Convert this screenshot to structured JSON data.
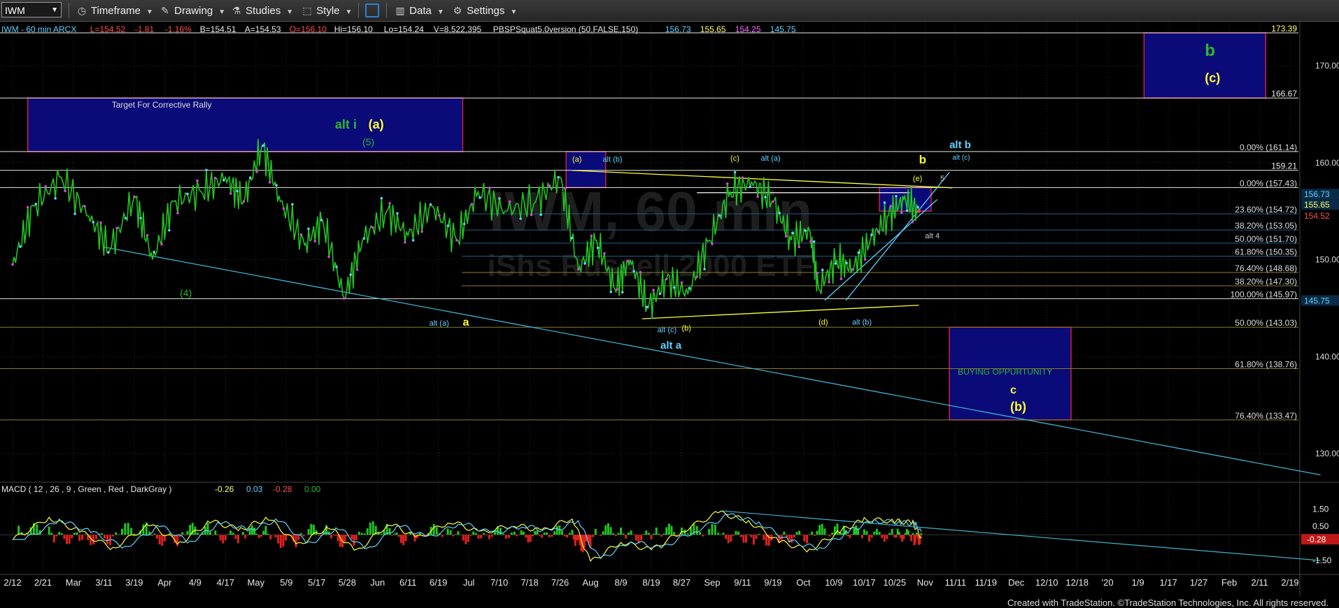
{
  "toolbar": {
    "symbol": "IWM",
    "items": [
      {
        "icon": "clock-icon",
        "label": "Timeframe"
      },
      {
        "icon": "pencil-icon",
        "label": "Drawing"
      },
      {
        "icon": "flask-icon",
        "label": "Studies"
      },
      {
        "icon": "brush-icon",
        "label": "Style"
      },
      {
        "icon": "layout-icon",
        "label": ""
      },
      {
        "icon": "bar-chart-icon",
        "label": "Data"
      },
      {
        "icon": "gear-icon",
        "label": "Settings"
      }
    ]
  },
  "header": {
    "title": "IWM - 60 min  ARCX",
    "stats": [
      {
        "text": "L=154.52",
        "color": "#ff4d4d"
      },
      {
        "text": "-1.81",
        "color": "#ff4d4d"
      },
      {
        "text": "-1.16%",
        "color": "#ff4d4d"
      },
      {
        "text": "B=154.51",
        "color": "#e8e8e8"
      },
      {
        "text": "A=154.53",
        "color": "#e8e8e8"
      },
      {
        "text": "O=156.10",
        "color": "#ff4d4d"
      },
      {
        "text": "Hi=156.10",
        "color": "#e8e8e8"
      },
      {
        "text": "Lo=154.24",
        "color": "#e8e8e8"
      },
      {
        "text": "V=8,522,395",
        "color": "#e8e8e8"
      },
      {
        "text": "PBSPSquat5.0version (50,FALSE,150)",
        "color": "#e8e8e8"
      },
      {
        "text": "156.73",
        "color": "#5fd3ff"
      },
      {
        "text": "155.65",
        "color": "#ffff66"
      },
      {
        "text": "154.25",
        "color": "#ff66ff"
      },
      {
        "text": "145.75",
        "color": "#5fd3ff"
      }
    ]
  },
  "watermark": {
    "line1": "IWM, 60 min",
    "line2": "iShs Russell 2000 ETF"
  },
  "footer": "Created with TradeStation. ©TradeStation Technologies, Inc. All rights reserved.",
  "chart_data": {
    "type": "line",
    "price_axis": {
      "ylim": [
        125,
        177
      ],
      "ticks": [
        130,
        140,
        150,
        160,
        170
      ]
    },
    "x_axis_labels": [
      "2/12",
      "2/21",
      "Mar",
      "3/11",
      "3/19",
      "Apr",
      "4/9",
      "4/17",
      "May",
      "5/9",
      "5/17",
      "5/28",
      "Jun",
      "6/11",
      "6/19",
      "Jul",
      "7/10",
      "7/18",
      "7/26",
      "Aug",
      "8/9",
      "8/19",
      "8/27",
      "Sep",
      "9/11",
      "9/19",
      "Oct",
      "10/9",
      "10/17",
      "10/25",
      "Nov",
      "11/11",
      "11/19",
      "Dec",
      "12/10",
      "12/18",
      "'20",
      "1/9",
      "1/17",
      "1/27",
      "Feb",
      "2/11",
      "2/19"
    ],
    "price_path": [
      {
        "x": 0,
        "y": 149.5
      },
      {
        "x": 0.7,
        "y": 155.5
      },
      {
        "x": 1.6,
        "y": 158.5
      },
      {
        "x": 2.5,
        "y": 154.5
      },
      {
        "x": 3.2,
        "y": 151
      },
      {
        "x": 4.0,
        "y": 156.5
      },
      {
        "x": 4.6,
        "y": 150
      },
      {
        "x": 5.3,
        "y": 156
      },
      {
        "x": 6.2,
        "y": 157
      },
      {
        "x": 7.0,
        "y": 158.5
      },
      {
        "x": 7.6,
        "y": 156
      },
      {
        "x": 8.2,
        "y": 161.8
      },
      {
        "x": 8.8,
        "y": 156
      },
      {
        "x": 9.6,
        "y": 151.5
      },
      {
        "x": 10.2,
        "y": 154
      },
      {
        "x": 10.9,
        "y": 146
      },
      {
        "x": 11.5,
        "y": 152
      },
      {
        "x": 12.3,
        "y": 155
      },
      {
        "x": 13.0,
        "y": 152.5
      },
      {
        "x": 13.8,
        "y": 155.5
      },
      {
        "x": 14.6,
        "y": 152
      },
      {
        "x": 15.3,
        "y": 157
      },
      {
        "x": 16.2,
        "y": 155
      },
      {
        "x": 17.2,
        "y": 156
      },
      {
        "x": 18.0,
        "y": 158.5
      },
      {
        "x": 18.6,
        "y": 149
      },
      {
        "x": 19.2,
        "y": 152
      },
      {
        "x": 19.8,
        "y": 147
      },
      {
        "x": 20.3,
        "y": 150
      },
      {
        "x": 20.9,
        "y": 145
      },
      {
        "x": 21.5,
        "y": 148
      },
      {
        "x": 22.2,
        "y": 146.5
      },
      {
        "x": 22.9,
        "y": 152
      },
      {
        "x": 23.6,
        "y": 157
      },
      {
        "x": 24.3,
        "y": 158
      },
      {
        "x": 25.0,
        "y": 156
      },
      {
        "x": 25.6,
        "y": 152
      },
      {
        "x": 26.2,
        "y": 153
      },
      {
        "x": 26.5,
        "y": 147
      },
      {
        "x": 27.1,
        "y": 150
      },
      {
        "x": 27.6,
        "y": 149
      },
      {
        "x": 28.2,
        "y": 152
      },
      {
        "x": 28.8,
        "y": 154.5
      },
      {
        "x": 29.3,
        "y": 156.2
      },
      {
        "x": 29.8,
        "y": 155
      }
    ],
    "fib_levels": [
      {
        "label": "0.00% (161.14)",
        "value": 161.14
      },
      {
        "label": "0.00% (157.43)",
        "value": 157.43
      },
      {
        "label": "23.60% (154.72)",
        "value": 154.72
      },
      {
        "label": "38.20% (153.05)",
        "value": 153.05
      },
      {
        "label": "50.00% (151.70)",
        "value": 151.7
      },
      {
        "label": "61.80% (150.35)",
        "value": 150.35
      },
      {
        "label": "76.40% (148.68)",
        "value": 148.68
      },
      {
        "label": "38.20% (147.30)",
        "value": 147.3
      },
      {
        "label": "100.00% (145.97)",
        "value": 145.97
      },
      {
        "label": "50.00% (143.03)",
        "value": 143.03
      },
      {
        "label": "61.80% (138.76)",
        "value": 138.76
      },
      {
        "label": "76.40% (133.47)",
        "value": 133.47
      }
    ],
    "price_levels": [
      {
        "label": "173.39",
        "value": 173.39
      },
      {
        "label": "166.67",
        "value": 166.67
      },
      {
        "label": "159.21",
        "value": 159.21
      }
    ],
    "right_tags": [
      {
        "label": "156.73",
        "value": 156.73,
        "color": "#5fd3ff"
      },
      {
        "label": "155.65",
        "value": 155.65,
        "color": "#ffff66"
      },
      {
        "label": "154.52",
        "value": 154.52,
        "color": "#ff4d4d"
      },
      {
        "label": "145.75",
        "value": 145.75,
        "color": "#5fd3ff"
      }
    ],
    "target_boxes": [
      {
        "name": "corrective-rally-target",
        "label": "Target For Corrective Rally",
        "x0": 0.5,
        "x1": 14.8,
        "y0": 161.14,
        "y1": 166.67
      },
      {
        "name": "a-box",
        "label": "",
        "x0": 18.2,
        "x1": 19.5,
        "y0": 157.43,
        "y1": 161.14
      },
      {
        "name": "e-box",
        "label": "",
        "x0": 28.5,
        "x1": 30.2,
        "y0": 155,
        "y1": 157.43
      },
      {
        "name": "b-target",
        "label": "",
        "x0": 37.2,
        "x1": 41.2,
        "y0": 166.67,
        "y1": 173.39
      },
      {
        "name": "buying-opportunity",
        "label": "BUYING OPPURTUNITY",
        "x0": 30.8,
        "x1": 34.8,
        "y0": 133.47,
        "y1": 143.03
      }
    ],
    "wave_labels": [
      {
        "text": "alt i",
        "x": 10.6,
        "y": 163.5,
        "color": "#2db82d",
        "size": 18
      },
      {
        "text": "(a)",
        "x": 11.7,
        "y": 163.5,
        "color": "#ffff33",
        "size": 18
      },
      {
        "text": "(5)",
        "x": 11.5,
        "y": 161.8,
        "color": "#2db82d",
        "size": 14
      },
      {
        "text": "(4)",
        "x": 5.5,
        "y": 146.2,
        "color": "#2db82d",
        "size": 14
      },
      {
        "text": "alt (a)",
        "x": 13.7,
        "y": 143.2,
        "color": "#5fd3ff",
        "size": 11
      },
      {
        "text": "a",
        "x": 14.8,
        "y": 143.2,
        "color": "#ffff33",
        "size": 16
      },
      {
        "text": "(a)",
        "x": 18.4,
        "y": 160.1,
        "color": "#ffff33",
        "size": 11
      },
      {
        "text": "alt (b)",
        "x": 19.4,
        "y": 160.1,
        "color": "#5fd3ff",
        "size": 11
      },
      {
        "text": "(c)",
        "x": 23.6,
        "y": 160.2,
        "color": "#ffff33",
        "size": 11
      },
      {
        "text": "alt (a)",
        "x": 24.6,
        "y": 160.2,
        "color": "#5fd3ff",
        "size": 11
      },
      {
        "text": "alt (c)",
        "x": 21.2,
        "y": 142.5,
        "color": "#5fd3ff",
        "size": 11
      },
      {
        "text": "(b)",
        "x": 22.0,
        "y": 142.7,
        "color": "#ffff33",
        "size": 11
      },
      {
        "text": "alt a",
        "x": 21.3,
        "y": 140.8,
        "color": "#5fd3ff",
        "size": 15
      },
      {
        "text": "(d)",
        "x": 26.5,
        "y": 143.3,
        "color": "#ffff33",
        "size": 11
      },
      {
        "text": "alt (b)",
        "x": 27.6,
        "y": 143.3,
        "color": "#5fd3ff",
        "size": 11
      },
      {
        "text": "(e)",
        "x": 29.6,
        "y": 158.1,
        "color": "#ffff33",
        "size": 11
      },
      {
        "text": "5",
        "x": 30.5,
        "y": 158.1,
        "color": "#cccccc",
        "size": 11
      },
      {
        "text": "b",
        "x": 29.8,
        "y": 159.9,
        "color": "#ffff33",
        "size": 17
      },
      {
        "text": "alt b",
        "x": 30.8,
        "y": 161.5,
        "color": "#5fd3ff",
        "size": 15
      },
      {
        "text": "alt (c)",
        "x": 30.9,
        "y": 160.3,
        "color": "#5fd3ff",
        "size": 10
      },
      {
        "text": "alt 4",
        "x": 30.0,
        "y": 152.2,
        "color": "#cccccc",
        "size": 11
      },
      {
        "text": "b",
        "x": 39.2,
        "y": 171.0,
        "color": "#2db82d",
        "size": 24
      },
      {
        "text": "(c)",
        "x": 39.2,
        "y": 168.3,
        "color": "#ffff33",
        "size": 18
      },
      {
        "text": "c",
        "x": 32.8,
        "y": 136.2,
        "color": "#ffff33",
        "size": 16
      },
      {
        "text": "(b)",
        "x": 32.8,
        "y": 134.4,
        "color": "#ffff33",
        "size": 18
      }
    ],
    "trendlines": [
      {
        "x0": 18.4,
        "y0": 159.2,
        "x1": 30.9,
        "y1": 157.4,
        "color": "#ffff33"
      },
      {
        "x0": 20.7,
        "y0": 143.9,
        "x1": 29.8,
        "y1": 145.3,
        "color": "#ffff33"
      },
      {
        "x0": 26.7,
        "y0": 145.8,
        "x1": 30.4,
        "y1": 156.2,
        "color": "#5fd3ff"
      },
      {
        "x0": 27.4,
        "y0": 145.8,
        "x1": 30.8,
        "y1": 159.0,
        "color": "#5fd3ff"
      },
      {
        "x0": 3.0,
        "y0": 151.3,
        "x1": 43.0,
        "y1": 127.8,
        "color": "#3fb0d0"
      },
      {
        "x0": 22.5,
        "y0": 156.9,
        "x1": 29.5,
        "y1": 156.9,
        "color": "#ffffff"
      }
    ],
    "macd": {
      "label": "MACD ( 12 , 26 , 9 , Green , Red , DarkGray )",
      "values": [
        {
          "text": "-0.26",
          "color": "#ffff66"
        },
        {
          "text": "0.03",
          "color": "#5fd3ff"
        },
        {
          "text": "-0.28",
          "color": "#ff4d4d"
        },
        {
          "text": "0.00",
          "color": "#2db82d"
        }
      ],
      "ylim": [
        -2.0,
        2.0
      ],
      "ticks": [
        "1.50",
        "0.50",
        "-1.50"
      ],
      "current_tag": "-0.28",
      "macd_line": [
        {
          "x": 0,
          "y": -0.3
        },
        {
          "x": 1.2,
          "y": 1.0
        },
        {
          "x": 2.2,
          "y": 0.2
        },
        {
          "x": 3.3,
          "y": -0.8
        },
        {
          "x": 4.5,
          "y": 0.6
        },
        {
          "x": 5.5,
          "y": -0.5
        },
        {
          "x": 6.5,
          "y": 0.8
        },
        {
          "x": 7.5,
          "y": 0.3
        },
        {
          "x": 8.4,
          "y": 1.0
        },
        {
          "x": 9.4,
          "y": -0.6
        },
        {
          "x": 10.4,
          "y": 0.5
        },
        {
          "x": 11.3,
          "y": -1.0
        },
        {
          "x": 12.4,
          "y": 0.7
        },
        {
          "x": 13.3,
          "y": -0.2
        },
        {
          "x": 14.4,
          "y": 0.8
        },
        {
          "x": 15.4,
          "y": 0.1
        },
        {
          "x": 16.5,
          "y": 0.6
        },
        {
          "x": 17.4,
          "y": 0.2
        },
        {
          "x": 18.4,
          "y": 1.0
        },
        {
          "x": 19.0,
          "y": -1.6
        },
        {
          "x": 20.0,
          "y": -0.4
        },
        {
          "x": 21.0,
          "y": -0.9
        },
        {
          "x": 22.0,
          "y": 0.2
        },
        {
          "x": 23.2,
          "y": 1.3
        },
        {
          "x": 24.2,
          "y": 0.8
        },
        {
          "x": 25.2,
          "y": -0.4
        },
        {
          "x": 26.2,
          "y": -0.9
        },
        {
          "x": 27.2,
          "y": 0.2
        },
        {
          "x": 28.0,
          "y": 0.9
        },
        {
          "x": 29.0,
          "y": 0.8
        },
        {
          "x": 29.6,
          "y": 0.7
        },
        {
          "x": 29.9,
          "y": -0.26
        }
      ],
      "trendline": {
        "x0": 23.3,
        "y0": 1.4,
        "x1": 43.0,
        "y1": -1.5
      }
    }
  }
}
